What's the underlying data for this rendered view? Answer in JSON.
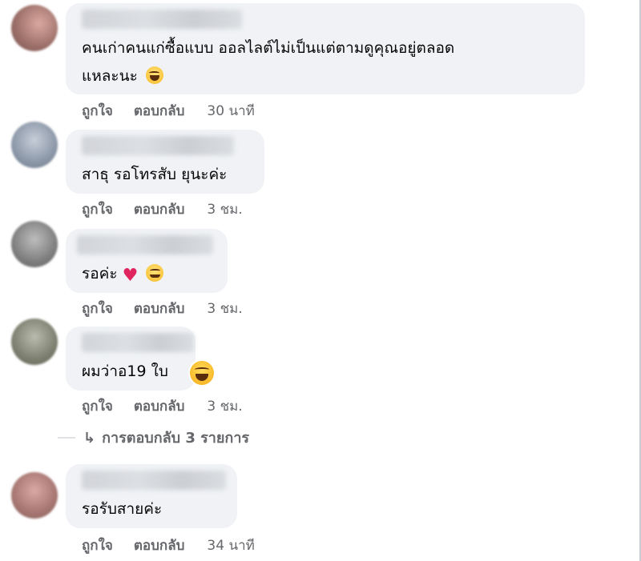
{
  "comments": [
    {
      "text_lines": [
        "คนเก่าคนแก่ซื้อแบบ ออลไลต์ไม่เป็นแต่ตามดูคุณอยู่ตลอด",
        "แหละนะ"
      ],
      "emoji": "grinning-squint-face",
      "like_label": "ถูกใจ",
      "reply_label": "ตอบกลับ",
      "time": "30 นาที"
    },
    {
      "text_lines": [
        "สาธุ รอโทรสับ ยุนะค่ะ"
      ],
      "like_label": "ถูกใจ",
      "reply_label": "ตอบกลับ",
      "time": "3 ชม."
    },
    {
      "text_lines": [
        "รอค่ะ"
      ],
      "emoji": "red-heart, smiling-face",
      "like_label": "ถูกใจ",
      "reply_label": "ตอบกลับ",
      "time": "3 ชม."
    },
    {
      "text_lines": [
        "ผมว่าอ19 ใบ"
      ],
      "reaction": "haha-reaction",
      "like_label": "ถูกใจ",
      "reply_label": "ตอบกลับ",
      "time": "3 ชม."
    },
    {
      "text_lines": [
        "รอรับสายค่ะ"
      ],
      "like_label": "ถูกใจ",
      "reply_label": "ตอบกลับ",
      "time": "34 นาที"
    }
  ],
  "replies_link": {
    "arrow": "↳",
    "label": "การตอบกลับ 3 รายการ"
  },
  "colors": {
    "bubble": "#f0f2f5",
    "meta_text": "#65676b",
    "heart": "#e0245e"
  }
}
